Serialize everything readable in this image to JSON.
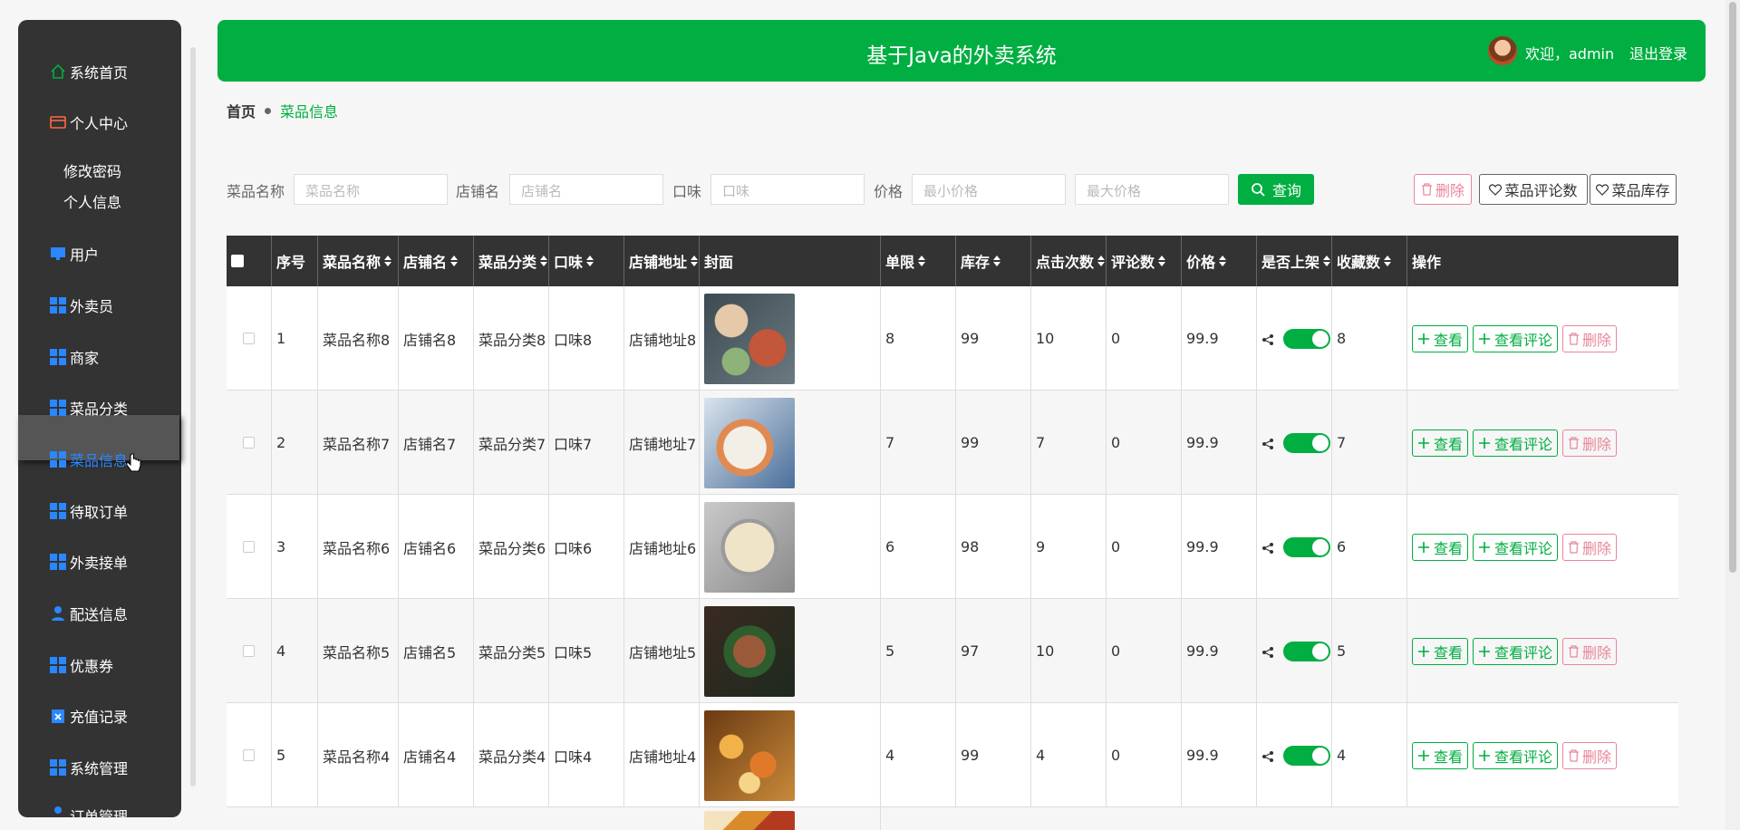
{
  "app": {
    "title": "基于Java的外卖系统",
    "welcome": "欢迎，admin",
    "logout": "退出登录"
  },
  "sidebar": {
    "items": [
      {
        "label": "系统首页",
        "icon": "home-icon"
      },
      {
        "label": "个人中心",
        "icon": "wallet-icon"
      },
      {
        "label": "用户",
        "icon": "monitor-icon"
      },
      {
        "label": "外卖员",
        "icon": "grid-icon"
      },
      {
        "label": "商家",
        "icon": "grid-icon"
      },
      {
        "label": "菜品分类",
        "icon": "grid-icon"
      },
      {
        "label": "菜品信息",
        "icon": "grid-icon"
      },
      {
        "label": "待取订单",
        "icon": "grid-icon"
      },
      {
        "label": "外卖接单",
        "icon": "grid-icon"
      },
      {
        "label": "配送信息",
        "icon": "user-icon"
      },
      {
        "label": "优惠券",
        "icon": "grid-icon"
      },
      {
        "label": "充值记录",
        "icon": "clipboard-icon"
      },
      {
        "label": "系统管理",
        "icon": "grid-icon"
      },
      {
        "label": "订单管理",
        "icon": "user-icon"
      }
    ],
    "sub_items": [
      "修改密码",
      "个人信息"
    ]
  },
  "breadcrumb": {
    "home": "首页",
    "current": "菜品信息"
  },
  "search": {
    "dish_name_label": "菜品名称",
    "dish_name_placeholder": "菜品名称",
    "shop_label": "店铺名",
    "shop_placeholder": "店铺名",
    "taste_label": "口味",
    "taste_placeholder": "口味",
    "price_label": "价格",
    "min_price_placeholder": "最小价格",
    "max_price_placeholder": "最大价格",
    "query_button": "查询",
    "delete_button": "删除",
    "comment_count_button": "菜品评论数",
    "stock_button": "菜品库存"
  },
  "table": {
    "headers": [
      "序号",
      "菜品名称",
      "店铺名",
      "菜品分类",
      "口味",
      "店铺地址",
      "封面",
      "单限",
      "库存",
      "点击次数",
      "评论数",
      "价格",
      "是否上架",
      "收藏数",
      "操作"
    ],
    "rows": [
      {
        "no": "1",
        "name": "菜品名称8",
        "shop": "店铺名8",
        "category": "菜品分类8",
        "taste": "口味8",
        "address": "店铺地址8",
        "limit": "8",
        "stock": "99",
        "clicks": "10",
        "comments": "0",
        "price": "99.9",
        "favorites": "8"
      },
      {
        "no": "2",
        "name": "菜品名称7",
        "shop": "店铺名7",
        "category": "菜品分类7",
        "taste": "口味7",
        "address": "店铺地址7",
        "limit": "7",
        "stock": "99",
        "clicks": "7",
        "comments": "0",
        "price": "99.9",
        "favorites": "7"
      },
      {
        "no": "3",
        "name": "菜品名称6",
        "shop": "店铺名6",
        "category": "菜品分类6",
        "taste": "口味6",
        "address": "店铺地址6",
        "limit": "6",
        "stock": "98",
        "clicks": "9",
        "comments": "0",
        "price": "99.9",
        "favorites": "6"
      },
      {
        "no": "4",
        "name": "菜品名称5",
        "shop": "店铺名5",
        "category": "菜品分类5",
        "taste": "口味5",
        "address": "店铺地址5",
        "limit": "5",
        "stock": "97",
        "clicks": "10",
        "comments": "0",
        "price": "99.9",
        "favorites": "5"
      },
      {
        "no": "5",
        "name": "菜品名称4",
        "shop": "店铺名4",
        "category": "菜品分类4",
        "taste": "口味4",
        "address": "店铺地址4",
        "limit": "4",
        "stock": "99",
        "clicks": "4",
        "comments": "0",
        "price": "99.9",
        "favorites": "4"
      }
    ],
    "actions": {
      "view": "查看",
      "view_comments": "查看评论",
      "delete": "删除"
    }
  },
  "colors": {
    "accent": "#00ae41",
    "sidebar": "#333333",
    "active_text": "#2a87ff",
    "danger": "#e8869a"
  }
}
